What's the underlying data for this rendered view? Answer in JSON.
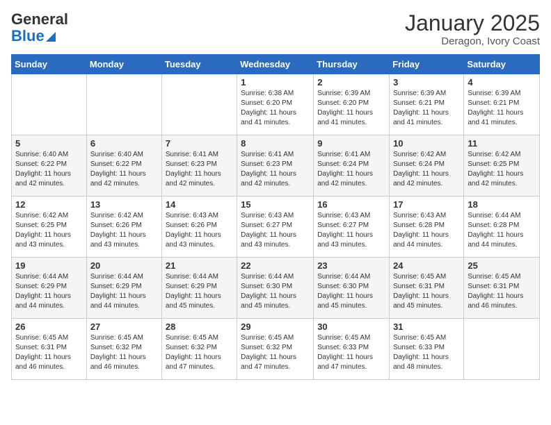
{
  "logo": {
    "general": "General",
    "blue": "Blue"
  },
  "title": {
    "month_year": "January 2025",
    "location": "Deragon, Ivory Coast"
  },
  "days_of_week": [
    "Sunday",
    "Monday",
    "Tuesday",
    "Wednesday",
    "Thursday",
    "Friday",
    "Saturday"
  ],
  "weeks": [
    [
      {
        "day": "",
        "info": ""
      },
      {
        "day": "",
        "info": ""
      },
      {
        "day": "",
        "info": ""
      },
      {
        "day": "1",
        "info": "Sunrise: 6:38 AM\nSunset: 6:20 PM\nDaylight: 11 hours and 41 minutes."
      },
      {
        "day": "2",
        "info": "Sunrise: 6:39 AM\nSunset: 6:20 PM\nDaylight: 11 hours and 41 minutes."
      },
      {
        "day": "3",
        "info": "Sunrise: 6:39 AM\nSunset: 6:21 PM\nDaylight: 11 hours and 41 minutes."
      },
      {
        "day": "4",
        "info": "Sunrise: 6:39 AM\nSunset: 6:21 PM\nDaylight: 11 hours and 41 minutes."
      }
    ],
    [
      {
        "day": "5",
        "info": "Sunrise: 6:40 AM\nSunset: 6:22 PM\nDaylight: 11 hours and 42 minutes."
      },
      {
        "day": "6",
        "info": "Sunrise: 6:40 AM\nSunset: 6:22 PM\nDaylight: 11 hours and 42 minutes."
      },
      {
        "day": "7",
        "info": "Sunrise: 6:41 AM\nSunset: 6:23 PM\nDaylight: 11 hours and 42 minutes."
      },
      {
        "day": "8",
        "info": "Sunrise: 6:41 AM\nSunset: 6:23 PM\nDaylight: 11 hours and 42 minutes."
      },
      {
        "day": "9",
        "info": "Sunrise: 6:41 AM\nSunset: 6:24 PM\nDaylight: 11 hours and 42 minutes."
      },
      {
        "day": "10",
        "info": "Sunrise: 6:42 AM\nSunset: 6:24 PM\nDaylight: 11 hours and 42 minutes."
      },
      {
        "day": "11",
        "info": "Sunrise: 6:42 AM\nSunset: 6:25 PM\nDaylight: 11 hours and 42 minutes."
      }
    ],
    [
      {
        "day": "12",
        "info": "Sunrise: 6:42 AM\nSunset: 6:25 PM\nDaylight: 11 hours and 43 minutes."
      },
      {
        "day": "13",
        "info": "Sunrise: 6:42 AM\nSunset: 6:26 PM\nDaylight: 11 hours and 43 minutes."
      },
      {
        "day": "14",
        "info": "Sunrise: 6:43 AM\nSunset: 6:26 PM\nDaylight: 11 hours and 43 minutes."
      },
      {
        "day": "15",
        "info": "Sunrise: 6:43 AM\nSunset: 6:27 PM\nDaylight: 11 hours and 43 minutes."
      },
      {
        "day": "16",
        "info": "Sunrise: 6:43 AM\nSunset: 6:27 PM\nDaylight: 11 hours and 43 minutes."
      },
      {
        "day": "17",
        "info": "Sunrise: 6:43 AM\nSunset: 6:28 PM\nDaylight: 11 hours and 44 minutes."
      },
      {
        "day": "18",
        "info": "Sunrise: 6:44 AM\nSunset: 6:28 PM\nDaylight: 11 hours and 44 minutes."
      }
    ],
    [
      {
        "day": "19",
        "info": "Sunrise: 6:44 AM\nSunset: 6:29 PM\nDaylight: 11 hours and 44 minutes."
      },
      {
        "day": "20",
        "info": "Sunrise: 6:44 AM\nSunset: 6:29 PM\nDaylight: 11 hours and 44 minutes."
      },
      {
        "day": "21",
        "info": "Sunrise: 6:44 AM\nSunset: 6:29 PM\nDaylight: 11 hours and 45 minutes."
      },
      {
        "day": "22",
        "info": "Sunrise: 6:44 AM\nSunset: 6:30 PM\nDaylight: 11 hours and 45 minutes."
      },
      {
        "day": "23",
        "info": "Sunrise: 6:44 AM\nSunset: 6:30 PM\nDaylight: 11 hours and 45 minutes."
      },
      {
        "day": "24",
        "info": "Sunrise: 6:45 AM\nSunset: 6:31 PM\nDaylight: 11 hours and 45 minutes."
      },
      {
        "day": "25",
        "info": "Sunrise: 6:45 AM\nSunset: 6:31 PM\nDaylight: 11 hours and 46 minutes."
      }
    ],
    [
      {
        "day": "26",
        "info": "Sunrise: 6:45 AM\nSunset: 6:31 PM\nDaylight: 11 hours and 46 minutes."
      },
      {
        "day": "27",
        "info": "Sunrise: 6:45 AM\nSunset: 6:32 PM\nDaylight: 11 hours and 46 minutes."
      },
      {
        "day": "28",
        "info": "Sunrise: 6:45 AM\nSunset: 6:32 PM\nDaylight: 11 hours and 47 minutes."
      },
      {
        "day": "29",
        "info": "Sunrise: 6:45 AM\nSunset: 6:32 PM\nDaylight: 11 hours and 47 minutes."
      },
      {
        "day": "30",
        "info": "Sunrise: 6:45 AM\nSunset: 6:33 PM\nDaylight: 11 hours and 47 minutes."
      },
      {
        "day": "31",
        "info": "Sunrise: 6:45 AM\nSunset: 6:33 PM\nDaylight: 11 hours and 48 minutes."
      },
      {
        "day": "",
        "info": ""
      }
    ]
  ]
}
